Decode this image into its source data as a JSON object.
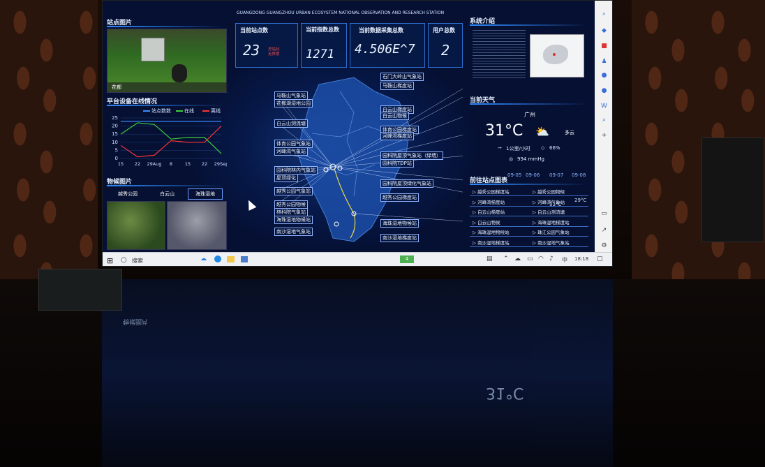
{
  "header": {
    "station_title": "GUANGDONG GUANGZHOU URBAN ECOSYSTEM NATIONAL OBSERVATION AND RESEARCH STATION"
  },
  "left": {
    "site_photo_title": "站点图片",
    "site_photo_caption": "花都",
    "online_title": "平台设备在线情况",
    "legend": [
      "站点数数",
      "在线",
      "离线"
    ],
    "phenology_title": "物候图片",
    "phenology_tabs": [
      "越秀公园",
      "白云山",
      "海珠湿地"
    ]
  },
  "stats": [
    {
      "label": "当前站点数",
      "value": "23",
      "note": "总站比\n无异常"
    },
    {
      "label": "当前指数总数",
      "value": "1271"
    },
    {
      "label": "当前数据采集总数",
      "value": "4.506E^7"
    },
    {
      "label": "用户总数",
      "value": "2"
    }
  ],
  "map_stations_left": [
    "马鞍山气象站",
    "花都湖湿地公园",
    "白云山测流塘",
    "体育公园气象站",
    "河峰湾气象站",
    "园科院林内气象站",
    "屋顶绿化",
    "越秀公园气象站",
    "越秀公园物候",
    "林科院气象站",
    "海珠湿地物候站",
    "南沙湿地气象站"
  ],
  "map_stations_right": [
    "石门大岭山气象站",
    "马鞍山梯度站",
    "白云山梯度站",
    "白云山物候",
    "体育公园梯度站",
    "河峰湾梯度站",
    "园科院屋顶气象站（绿墙）",
    "园科院TDP站",
    "园科院屋顶绿化气象站",
    "越秀公园梯度站",
    "海珠湿地物候站",
    "南沙湿地梯度站"
  ],
  "right": {
    "sys_title": "系统介绍",
    "weather_title": "当前天气",
    "city": "广州",
    "temp": "31°C",
    "condition": "多云",
    "wind": "1公里/小时",
    "humidity": "66%",
    "pressure": "994 mmHg",
    "forecast_dates": [
      "09-05",
      "09-06",
      "09-07",
      "09-08"
    ],
    "forecast_temps": [
      "31°C",
      "29°C"
    ],
    "goto_title": "前往站点图表",
    "goto_links": [
      [
        "越秀公园梯度站",
        "越秀公园物候"
      ],
      [
        "河峰湾梯度站",
        "河峰湾气象站"
      ],
      [
        "白云山梯度站",
        "白云山测流塘"
      ],
      [
        "白云山物候",
        "海珠湿地梯度站"
      ],
      [
        "海珠湿地物候站",
        "珠江公园气象站"
      ],
      [
        "南沙湿地梯度站",
        "南沙湿地气象站"
      ]
    ]
  },
  "chart_data": {
    "type": "line",
    "x": [
      "15",
      "22",
      "29Aug",
      "8",
      "15",
      "22",
      "29Sep"
    ],
    "ylim": [
      0,
      25
    ],
    "yticks": [
      0,
      5,
      10,
      15,
      20,
      25
    ],
    "series": [
      {
        "name": "站点数数",
        "color": "#3b8cff",
        "values": [
          23,
          23,
          23,
          23,
          23,
          23,
          23
        ]
      },
      {
        "name": "在线",
        "color": "#3ecf3e",
        "values": [
          15,
          22,
          21,
          12,
          13,
          13,
          3
        ]
      },
      {
        "name": "离线",
        "color": "#ff3333",
        "values": [
          8,
          1,
          2,
          11,
          10,
          10,
          20
        ]
      }
    ]
  },
  "taskbar": {
    "search_label": "搜索",
    "badge": "4",
    "ime": "中",
    "time": "18:18"
  },
  "colors": {
    "accent": "#2f8cff",
    "screen_bg": "#07194a"
  }
}
